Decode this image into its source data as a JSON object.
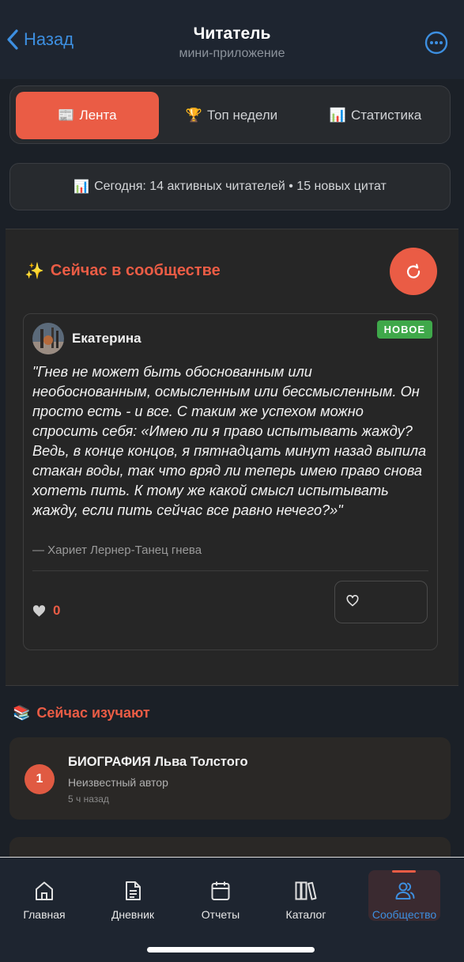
{
  "header": {
    "back_label": "Назад",
    "title": "Читатель",
    "subtitle": "мини-приложение"
  },
  "tabs": [
    {
      "icon": "📰",
      "label": "Лента",
      "active": true
    },
    {
      "icon": "🏆",
      "label": "Топ недели",
      "active": false
    },
    {
      "icon": "📊",
      "label": "Статистика",
      "active": false
    }
  ],
  "stats": {
    "icon": "📊",
    "text": "Сегодня: 14 активных читателей • 15 новых цитат"
  },
  "community": {
    "icon": "✨",
    "title": "Сейчас в сообществе",
    "card": {
      "author": "Екатерина",
      "badge": "НОВОЕ",
      "quote": "\"Гнев не может быть обоснованным или необоснованным, осмысленным или бессмысленным. Он просто есть - и все. С таким же успехом можно спросить себя: «Имею ли я право испытывать жажду? Ведь, в конце концов, я пятнадцать минут назад выпила стакан воды, так что вряд ли теперь имею право снова хотеть пить. К тому же какой смысл испытывать жажду, если пить сейчас все равно нечего?»\"",
      "source": "— Хариет Лернер-Танец гнева",
      "likes": "0"
    }
  },
  "learning": {
    "icon": "📚",
    "title": "Сейчас изучают",
    "items": [
      {
        "rank": "1",
        "title": "БИОГРАФИЯ Льва Толстого",
        "author": "Неизвестный автор",
        "time": "5 ч назад"
      }
    ]
  },
  "nav": [
    {
      "label": "Главная",
      "icon": "home-icon",
      "active": false
    },
    {
      "label": "Дневник",
      "icon": "document-icon",
      "active": false
    },
    {
      "label": "Отчеты",
      "icon": "calendar-icon",
      "active": false
    },
    {
      "label": "Каталог",
      "icon": "books-icon",
      "active": false
    },
    {
      "label": "Сообщество",
      "icon": "users-icon",
      "active": true
    }
  ],
  "colors": {
    "accent": "#ea5c45",
    "link": "#3d8fe0",
    "badge": "#3fa84a",
    "background": "#1b2027"
  }
}
